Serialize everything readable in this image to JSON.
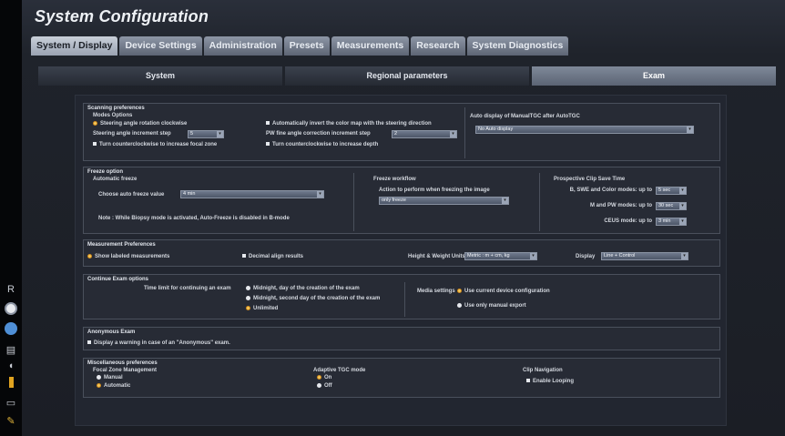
{
  "title": "System Configuration",
  "tabs": [
    "System / Display",
    "Device Settings",
    "Administration",
    "Presets",
    "Measurements",
    "Research",
    "System Diagnostics"
  ],
  "subtabs": [
    "System",
    "Regional parameters",
    "Exam"
  ],
  "left_bar": [
    "R"
  ],
  "scanning": {
    "title": "Scanning preferences",
    "modes_title": "Modes Options",
    "steer_rot": "Steering angle rotation clockwise",
    "steer_inc_label": "Steering angle increment step",
    "steer_inc_value": "5",
    "ccw_focal": "Turn counterclockwise to increase focal zone",
    "auto_invert": "Automatically invert the color map with the steering direction",
    "pw_label": "PW fine angle correction increment step",
    "pw_value": "2",
    "ccw_depth": "Turn counterclockwise to increase depth",
    "auto_tgc_title": "Auto display of ManualTGC after AutoTGC",
    "auto_tgc_value": "No Auto display"
  },
  "freeze": {
    "title": "Freeze option",
    "auto_title": "Automatic freeze",
    "choose_label": "Choose auto freeze value",
    "choose_value": "4 min",
    "note": "Note : While Biopsy mode is activated, Auto-Freeze is disabled in B-mode",
    "workflow_title": "Freeze workflow",
    "action_label": "Action to perform when freezing the image",
    "action_value": "only freeze",
    "clip_title": "Prospective Clip Save Time",
    "clip_b_label": "B, SWE and Color modes: up to",
    "clip_b_value": "5 sec",
    "clip_m_label": "M and PW modes: up to",
    "clip_m_value": "30 sec",
    "clip_ceus_label": "CEUS mode: up to",
    "clip_ceus_value": "3 min"
  },
  "measurement": {
    "title": "Measurement Preferences",
    "show_labeled": "Show labeled measurements",
    "decimal_align": "Decimal align results",
    "hw_label": "Height & Weight Units",
    "hw_value": "Metric : m + cm, kg",
    "display_label": "Display",
    "display_value": "Line + Control"
  },
  "continue": {
    "title": "Continue Exam options",
    "limit_label": "Time limit for continuing an exam",
    "opt1": "Midnight, day of the creation of the exam",
    "opt2": "Midnight, second day of the creation of the exam",
    "opt3": "Unlimited",
    "media_label": "Media settings",
    "media1": "Use current device configuration",
    "media2": "Use only manual export"
  },
  "anonymous": {
    "title": "Anonymous Exam",
    "warning": "Display a warning in case of an \"Anonymous\" exam."
  },
  "misc": {
    "title": "Miscellaneous preferences",
    "focal_title": "Focal Zone Management",
    "focal_manual": "Manual",
    "focal_auto": "Automatic",
    "tgc_title": "Adaptive TGC mode",
    "tgc_on": "On",
    "tgc_off": "Off",
    "clip_title": "Clip Navigation",
    "enable_looping": "Enable Looping"
  },
  "colors": {
    "accent": "#f2c85b",
    "active_tab": "#c9cfd9",
    "panel": "#272b35"
  }
}
